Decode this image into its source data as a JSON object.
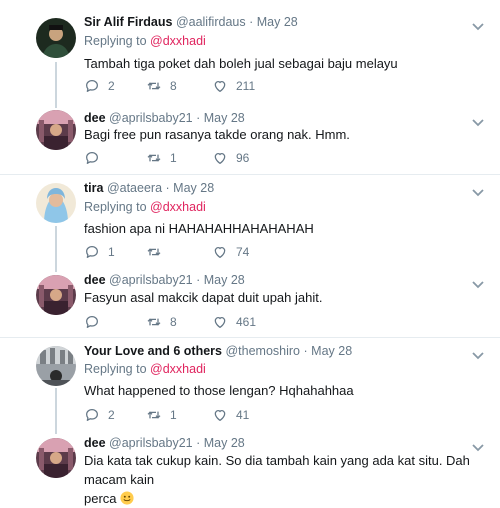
{
  "tweets": [
    {
      "name": "Sir Alif Firdaus",
      "handle": "@aalifirdaus",
      "sep": "·",
      "date": "May 28",
      "reply_prefix": "Replying to",
      "reply_to": "@dxxhadi",
      "text": "Tambah tiga poket dah boleh jual sebagai baju melayu",
      "replies": "2",
      "retweets": "8",
      "likes": "211"
    },
    {
      "name": "dee",
      "handle": "@aprilsbaby21",
      "sep": "·",
      "date": "May 28",
      "text": "Bagi free pun rasanya takde orang nak. Hmm.",
      "replies": "",
      "retweets": "1",
      "likes": "96"
    },
    {
      "name": "tira",
      "handle": "@ataeera",
      "sep": "·",
      "date": "May 28",
      "reply_prefix": "Replying to",
      "reply_to": "@dxxhadi",
      "text": "fashion apa ni HAHAHAHHAHAHAHAH",
      "replies": "1",
      "retweets": "",
      "likes": "74"
    },
    {
      "name": "dee",
      "handle": "@aprilsbaby21",
      "sep": "·",
      "date": "May 28",
      "text": "Fasyun asal makcik dapat duit upah jahit.",
      "replies": "",
      "retweets": "8",
      "likes": "461"
    },
    {
      "name": "Your Love and 6 others",
      "handle": "@themoshiro",
      "sep": "·",
      "date": "May 28",
      "reply_prefix": "Replying to",
      "reply_to": "@dxxhadi",
      "text": "What happened to those lengan? Hqhahahhaa",
      "replies": "2",
      "retweets": "1",
      "likes": "41"
    },
    {
      "name": "dee",
      "handle": "@aprilsbaby21",
      "sep": "·",
      "date": "May 28",
      "text_line1": "Dia kata tak cukup kain. So dia tambah kain yang ada kat situ. Dah macam kain",
      "text_line2": "perca"
    }
  ],
  "colors": {
    "mention": "#e0245e",
    "muted": "#657786",
    "text": "#14171a",
    "separator": "#e6ecf0"
  },
  "icons": [
    "reply-icon",
    "retweet-icon",
    "like-icon",
    "chevron-down-icon",
    "smile-emoji-icon"
  ]
}
